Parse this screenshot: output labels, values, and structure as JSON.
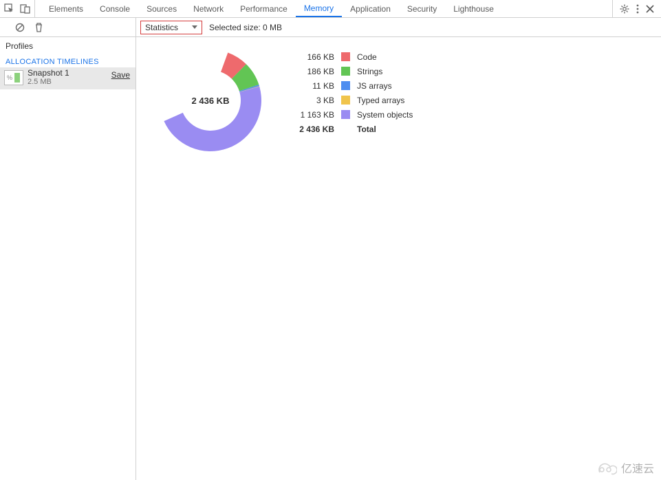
{
  "tabs": {
    "items": [
      {
        "label": "Elements",
        "active": false
      },
      {
        "label": "Console",
        "active": false
      },
      {
        "label": "Sources",
        "active": false
      },
      {
        "label": "Network",
        "active": false
      },
      {
        "label": "Performance",
        "active": false
      },
      {
        "label": "Memory",
        "active": true
      },
      {
        "label": "Application",
        "active": false
      },
      {
        "label": "Security",
        "active": false
      },
      {
        "label": "Lighthouse",
        "active": false
      }
    ]
  },
  "toolbar": {
    "dropdown_value": "Statistics",
    "status_text": "Selected size: 0 MB"
  },
  "sidebar": {
    "profiles_label": "Profiles",
    "section_label": "ALLOCATION TIMELINES",
    "snapshot": {
      "name": "Snapshot 1",
      "size": "2.5 MB",
      "save_label": "Save",
      "icon_text": "%"
    }
  },
  "chart_data": {
    "type": "pie",
    "total_label": "2 436 KB",
    "legend_total_category": "Total",
    "legend_total_value": "2 436 KB",
    "series": [
      {
        "name": "Code",
        "value_kb": 166,
        "value_label": "166 KB",
        "color": "#ee6a6d"
      },
      {
        "name": "Strings",
        "value_kb": 186,
        "value_label": "186 KB",
        "color": "#62c554"
      },
      {
        "name": "JS arrays",
        "value_kb": 11,
        "value_label": "11 KB",
        "color": "#4f8ef0"
      },
      {
        "name": "Typed arrays",
        "value_kb": 3,
        "value_label": "3 KB",
        "color": "#f0c44c"
      },
      {
        "name": "System objects",
        "value_kb": 1163,
        "value_label": "1 163 KB",
        "color": "#9a8cf2"
      }
    ],
    "numeric_total_kb": 2436,
    "arc_start_angle_deg": -70
  },
  "watermark": {
    "text": "亿速云"
  }
}
